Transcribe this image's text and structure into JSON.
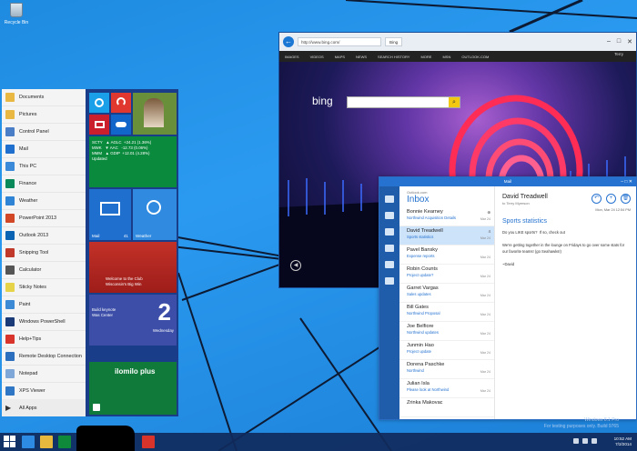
{
  "desktop": {
    "recycle_bin_label": "Recycle Bin"
  },
  "start_menu": {
    "apps": [
      {
        "label": "Documents",
        "icon": "folder-icon",
        "color": "#e8b842"
      },
      {
        "label": "Pictures",
        "icon": "pictures-icon",
        "color": "#e8b842"
      },
      {
        "label": "Control Panel",
        "icon": "control-panel-icon",
        "color": "#4a7fc8"
      },
      {
        "label": "Mail",
        "icon": "mail-icon",
        "color": "#1f6fcf"
      },
      {
        "label": "This PC",
        "icon": "computer-icon",
        "color": "#3b8ad9"
      },
      {
        "label": "Finance",
        "icon": "finance-icon",
        "color": "#0a8a5a"
      },
      {
        "label": "Weather",
        "icon": "weather-icon",
        "color": "#2f84d6"
      },
      {
        "label": "PowerPoint 2013",
        "icon": "powerpoint-icon",
        "color": "#d24726"
      },
      {
        "label": "Outlook 2013",
        "icon": "outlook-icon",
        "color": "#0a64b3"
      },
      {
        "label": "Snipping Tool",
        "icon": "scissors-icon",
        "color": "#c0392b"
      },
      {
        "label": "Calculator",
        "icon": "calculator-icon",
        "color": "#555555"
      },
      {
        "label": "Sticky Notes",
        "icon": "sticky-notes-icon",
        "color": "#e6d34a"
      },
      {
        "label": "Paint",
        "icon": "paint-icon",
        "color": "#3c8ad6"
      },
      {
        "label": "Windows PowerShell",
        "icon": "powershell-icon",
        "color": "#1b3a78"
      },
      {
        "label": "Help+Tips",
        "icon": "help-icon",
        "color": "#d9342b"
      },
      {
        "label": "Remote Desktop Connection",
        "icon": "remote-desktop-icon",
        "color": "#2c6fbf"
      },
      {
        "label": "Notepad",
        "icon": "notepad-icon",
        "color": "#7fa8d8"
      },
      {
        "label": "XPS Viewer",
        "icon": "xps-icon",
        "color": "#2f77c5"
      }
    ],
    "all_apps_label": "All Apps",
    "tiles": {
      "finance_text": "SCTY   ▲ AGLC  +24.21 (1.36%)\nMWK   ▼ AAC   -12.73 (0.06%)\nMMM   ▲ GDIP  +12.01 (4.28%)\nUpdated",
      "mail_label": "Mail",
      "mail_count": "41",
      "weather_label": "Weather",
      "sports_text": "Welcome to the Club\nWisconsin's Big Win",
      "calendar_text": "Build keynote\nWas Center",
      "calendar_day": "2",
      "calendar_weekday": "Wednesday",
      "game_text": "ilomilo plus"
    }
  },
  "ie": {
    "address": "http://www.bing.com/",
    "tab_title": "Bing",
    "menu_items": [
      "IMAGES",
      "VIDEOS",
      "MAPS",
      "NEWS",
      "SEARCH HISTORY",
      "MORE",
      "MSN",
      "OUTLOOK.COM"
    ],
    "user": "Terry",
    "bing_logo": "bing"
  },
  "mail": {
    "title": "Mail",
    "account": "Outlook.com",
    "folder": "Inbox",
    "messages": [
      {
        "sender": "Bonnie Kearney",
        "subject": "Northwind Acquisition Details",
        "date": "Mar 24",
        "count": "⊕"
      },
      {
        "sender": "David Treadwell",
        "subject": "Sports statistics",
        "date": "Mar 24",
        "count": "4",
        "selected": true
      },
      {
        "sender": "Pavel Bansky",
        "subject": "Expense reports",
        "date": "Mar 24"
      },
      {
        "sender": "Robin Counts",
        "subject": "Project update?",
        "date": "Mar 24"
      },
      {
        "sender": "Garret Vargas",
        "subject": "Sales updates",
        "date": "Mar 24"
      },
      {
        "sender": "Bill Gates",
        "subject": "Northwind Proposal",
        "date": "Mar 24"
      },
      {
        "sender": "Joe Belfiore",
        "subject": "Northwind updates",
        "date": "Mar 24"
      },
      {
        "sender": "Junmin Hao",
        "subject": "Project update",
        "date": "Mar 24"
      },
      {
        "sender": "Dorena Paschke",
        "subject": "Northwind",
        "date": "Mar 24"
      },
      {
        "sender": "Julian Isla",
        "subject": "Please look at Northwind",
        "date": "Mar 24"
      },
      {
        "sender": "Zrinka Makovac",
        "subject": "",
        "date": ""
      }
    ],
    "reading": {
      "from": "David Treadwell",
      "to": "to Terry Myerson",
      "date": "Mon, Mar 24   12:54 PM",
      "subject": "Sports statistics",
      "body": "Do you LIKE sports?  If so, check out\n\nWe're getting together in the lounge on Fridays to go over some stats for our favorite teams! (go Seahawks!)\n\n~David"
    }
  },
  "taskbar": {
    "time": "10:52 AM",
    "date": "7/2/2014",
    "watermark": "Windows 8.1 Pro\nFor testing purposes only. Build 9765"
  }
}
